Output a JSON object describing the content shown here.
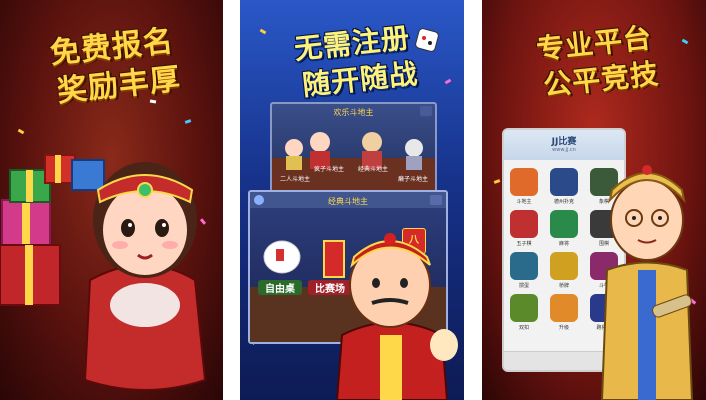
{
  "panel1": {
    "headline_line1": "免费报名",
    "headline_line2": "奖励丰厚"
  },
  "panel2": {
    "headline_line1": "无需注册",
    "headline_line2": "随开随战",
    "screen_top": {
      "title": "欢乐斗地主",
      "modes": [
        "二人斗地主",
        "疯子斗地主",
        "经典斗地主",
        "癞子斗地主"
      ]
    },
    "screen_bottom": {
      "title": "经典斗地主",
      "buttons": [
        "自由桌",
        "比赛场",
        "庆"
      ],
      "badge": "八"
    }
  },
  "panel3": {
    "headline_line1": "专业平台",
    "headline_line2": "公平竞技",
    "phone": {
      "title": "JJ比赛",
      "subtitle": "www.jj.cn",
      "apps": [
        "斗地主",
        "德州扑克",
        "象棋",
        "五子棋",
        "麻将",
        "围棋",
        "掼蛋",
        "桥牌",
        "斗牛",
        "双扣",
        "升级",
        "跑得快"
      ]
    }
  }
}
